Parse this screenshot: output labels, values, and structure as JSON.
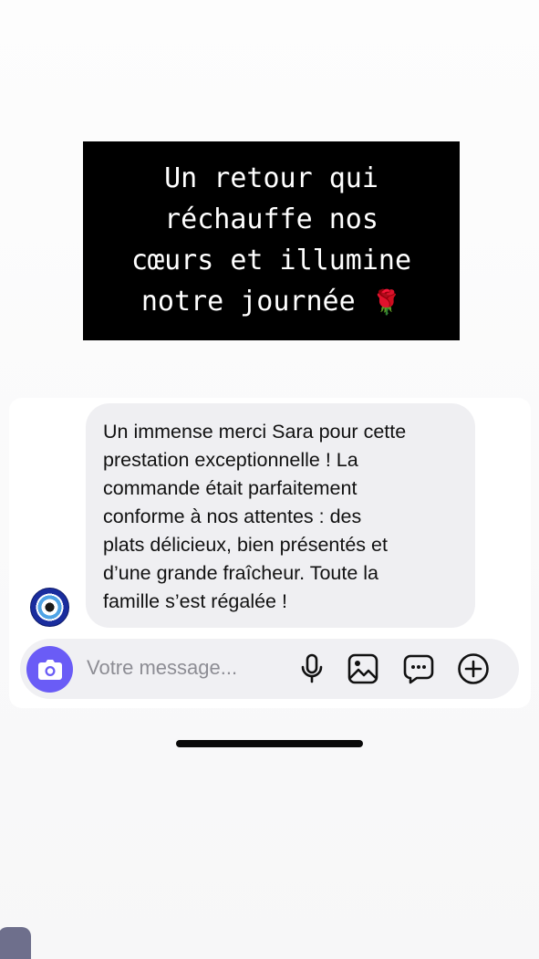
{
  "story": {
    "caption": "Un retour qui\nréchauffe nos\ncœurs et illumine\nnotre journée",
    "caption_emoji": "🌹"
  },
  "message": {
    "avatar_icon": "nazar-eye-icon",
    "text": "Un immense merci Sara pour cette\nprestation exceptionnelle ! La\ncommande était parfaitement\nconforme à nos attentes : des\nplats délicieux, bien présentés et\nd’une grande fraîcheur. Toute la\nfamille s’est régalée !"
  },
  "composer": {
    "placeholder": "Votre message...",
    "icons": [
      "camera-icon",
      "microphone-icon",
      "image-icon",
      "chat-bubble-icon",
      "plus-circle-icon"
    ],
    "accent_color": "#6a5cf6"
  }
}
